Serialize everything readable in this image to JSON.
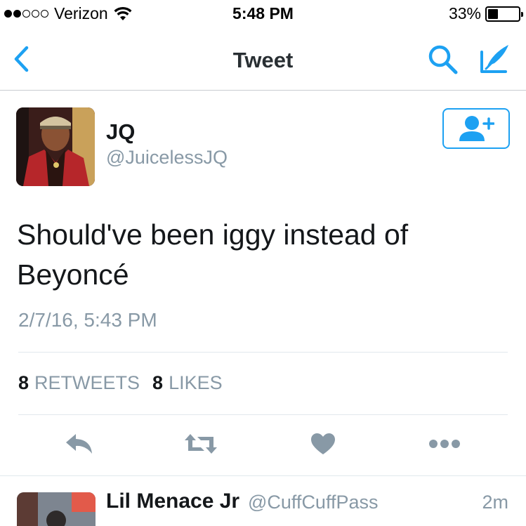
{
  "status_bar": {
    "carrier": "Verizon",
    "time": "5:48 PM",
    "battery_percent": "33%",
    "battery_level": 0.33,
    "signal_bars_filled": 2,
    "signal_bars_total": 5
  },
  "nav": {
    "title": "Tweet",
    "back_icon": "chevron-left-icon",
    "search_icon": "search-icon",
    "compose_icon": "compose-quill-icon"
  },
  "tweet": {
    "author_name": "JQ",
    "author_handle": "@JuicelessJQ",
    "text_line1": "Should've been iggy instead of",
    "text_line2": "Beyoncé",
    "timestamp": "2/7/16, 5:43 PM",
    "retweets_count": "8",
    "retweets_label": "RETWEETS",
    "likes_count": "8",
    "likes_label": "LIKES"
  },
  "actions": {
    "reply_icon": "reply-icon",
    "retweet_icon": "retweet-icon",
    "like_icon": "heart-icon",
    "more_icon": "more-dots-icon"
  },
  "reply": {
    "author_name": "Lil Menace Jr",
    "author_handle": "@CuffCuffPass",
    "time": "2m"
  },
  "colors": {
    "accent": "#1da1f2",
    "text": "#14171a",
    "muted": "#8899a6",
    "action_gray": "#8899a6"
  }
}
